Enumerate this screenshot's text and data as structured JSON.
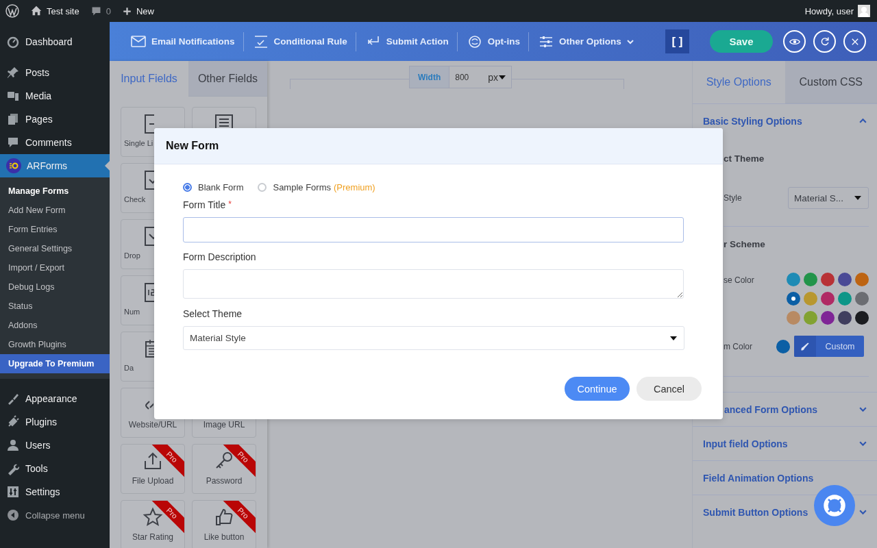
{
  "admin_bar": {
    "site": "Test site",
    "comments": "0",
    "new": "New",
    "greeting": "Howdy, user"
  },
  "wp_menu": {
    "items": [
      {
        "label": "Dashboard",
        "selected": false
      },
      {
        "label": "Posts",
        "selected": false
      },
      {
        "label": "Media",
        "selected": false
      },
      {
        "label": "Pages",
        "selected": false
      },
      {
        "label": "Comments",
        "selected": false
      },
      {
        "label": "ARForms",
        "selected": true,
        "children": [
          {
            "label": "Manage Forms",
            "selected": true,
            "kind": "link"
          },
          {
            "label": "Add New Form",
            "selected": false,
            "kind": "link"
          },
          {
            "label": "Form Entries",
            "selected": false,
            "kind": "link"
          },
          {
            "label": "General Settings",
            "selected": false,
            "kind": "link"
          },
          {
            "label": "Import / Export",
            "selected": false,
            "kind": "link"
          },
          {
            "label": "Debug Logs",
            "selected": false,
            "kind": "link"
          },
          {
            "label": "Status",
            "selected": false,
            "kind": "link"
          },
          {
            "label": "Addons",
            "selected": false,
            "kind": "link"
          },
          {
            "label": "Growth Plugins",
            "selected": false,
            "kind": "link"
          },
          {
            "label": "Upgrade To Premium",
            "selected": false,
            "kind": "upgrade"
          }
        ]
      },
      {
        "label": "Appearance",
        "selected": false
      },
      {
        "label": "Plugins",
        "selected": false
      },
      {
        "label": "Users",
        "selected": false
      },
      {
        "label": "Tools",
        "selected": false
      },
      {
        "label": "Settings",
        "selected": false
      }
    ],
    "collapse": "Collapse menu"
  },
  "toolbar": {
    "items": [
      {
        "label": "Email Notifications",
        "dropdown": false
      },
      {
        "label": "Conditional Rule",
        "dropdown": false
      },
      {
        "label": "Submit Action",
        "dropdown": false
      },
      {
        "label": "Opt-ins",
        "dropdown": false
      },
      {
        "label": "Other Options",
        "dropdown": true
      }
    ],
    "shortcode": "[ ]",
    "save": "Save"
  },
  "field_panel": {
    "tabs": [
      {
        "label": "Input Fields",
        "selected": true
      },
      {
        "label": "Other Fields",
        "selected": false
      }
    ],
    "tile_rows": [
      [
        {
          "label": "Single Li"
        }
      ],
      [
        {
          "label": "Check"
        }
      ],
      [
        {
          "label": "Drop"
        }
      ],
      [
        {
          "label": "Num"
        }
      ],
      [
        {
          "label": "Da"
        }
      ],
      [
        {
          "label": "Website/URL"
        },
        {
          "label": "Image URL"
        }
      ],
      [
        {
          "label": "File Upload",
          "badge": "Pro"
        },
        {
          "label": "Password",
          "badge": "Pro"
        }
      ],
      [
        {
          "label": "Star Rating",
          "badge": "Pro"
        },
        {
          "label": "Like button",
          "badge": "Pro"
        }
      ]
    ]
  },
  "canvas": {
    "width_label": "Width",
    "width_value": "800",
    "unit": "px"
  },
  "style_panel": {
    "tabs": [
      {
        "label": "Style Options",
        "selected": true
      },
      {
        "label": "Custom CSS",
        "selected": false
      }
    ],
    "sections": [
      {
        "title": "Basic Styling Options",
        "expanded": true
      },
      {
        "title": "anced Form Options",
        "expanded": false
      },
      {
        "title": "Input field Options",
        "expanded": false
      },
      {
        "title": "Field Animation Options"
      },
      {
        "title": "Submit Button Options",
        "expanded": false
      }
    ],
    "theme": {
      "heading": "ct Theme",
      "label": "Style",
      "value": "Material S..."
    },
    "color_scheme": {
      "heading": "r Scheme",
      "label": "se Color",
      "swatches": [
        {
          "color": "#1e8bb5",
          "selected": false
        },
        {
          "color": "#22944a",
          "selected": false
        },
        {
          "color": "#b83236",
          "selected": false
        },
        {
          "color": "#4a4a96",
          "selected": false
        },
        {
          "color": "#bd6412",
          "selected": false
        },
        {
          "color": "#0b5fa5",
          "selected": true
        },
        {
          "color": "#b8972f",
          "selected": false
        },
        {
          "color": "#b02a64",
          "selected": false
        },
        {
          "color": "#0d9688",
          "selected": false
        },
        {
          "color": "#6b6d72",
          "selected": false
        },
        {
          "color": "#b88a63",
          "selected": false
        },
        {
          "color": "#82a232",
          "selected": false
        },
        {
          "color": "#7f2596",
          "selected": false
        },
        {
          "color": "#403e5e",
          "selected": false
        },
        {
          "color": "#1b1c20",
          "selected": false
        }
      ],
      "custom": {
        "label": "m Color",
        "color": "#0b5fa5",
        "button": "Custom"
      }
    }
  },
  "modal": {
    "title": "New Form",
    "options": [
      {
        "label": "Blank Form",
        "selected": true
      },
      {
        "label": "Sample Forms",
        "note": "(Premium)",
        "selected": false
      }
    ],
    "title_label": "Form Title",
    "required_mark": "*",
    "description_label": "Form Description",
    "theme_label": "Select Theme",
    "theme_value": "Material Style",
    "primary_button": "Continue",
    "secondary_button": "Cancel"
  }
}
